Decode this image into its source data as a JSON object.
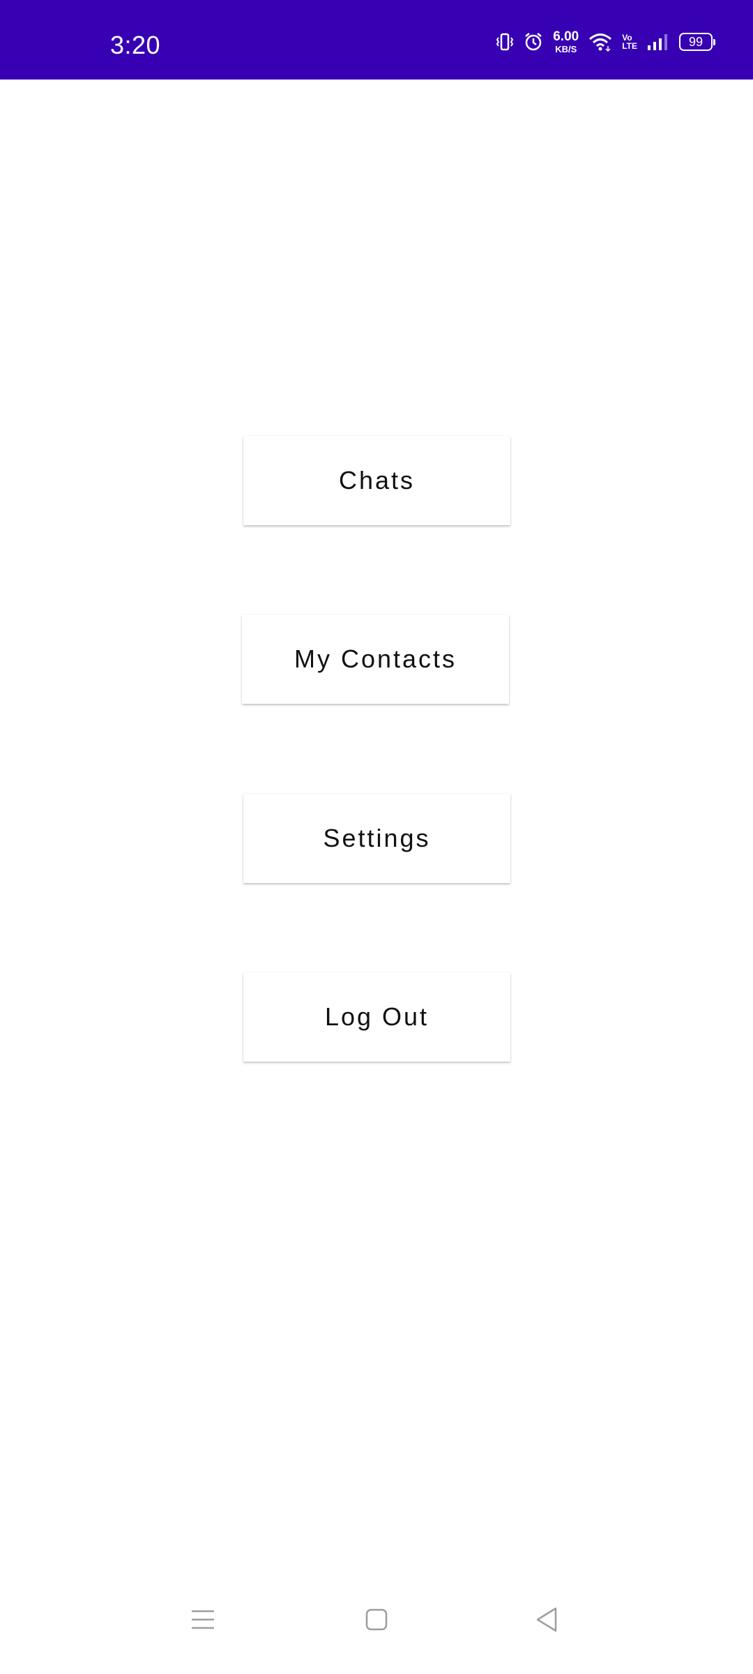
{
  "status_bar": {
    "time": "3:20",
    "net_speed_value": "6.00",
    "net_speed_unit": "KB/S",
    "volte_top": "Vo",
    "volte_bottom": "LTE",
    "battery_level": "99",
    "icons": [
      "vibrate-icon",
      "alarm-icon",
      "wifi-icon",
      "volte-icon",
      "signal-icon",
      "battery-icon"
    ],
    "background_color": "#3700b3"
  },
  "menu": {
    "chats_label": "Chats",
    "contacts_label": "My Contacts",
    "settings_label": "Settings",
    "logout_label": "Log Out"
  },
  "nav_bar": {
    "icons": [
      "recents-menu-icon",
      "home-icon",
      "back-icon"
    ]
  }
}
